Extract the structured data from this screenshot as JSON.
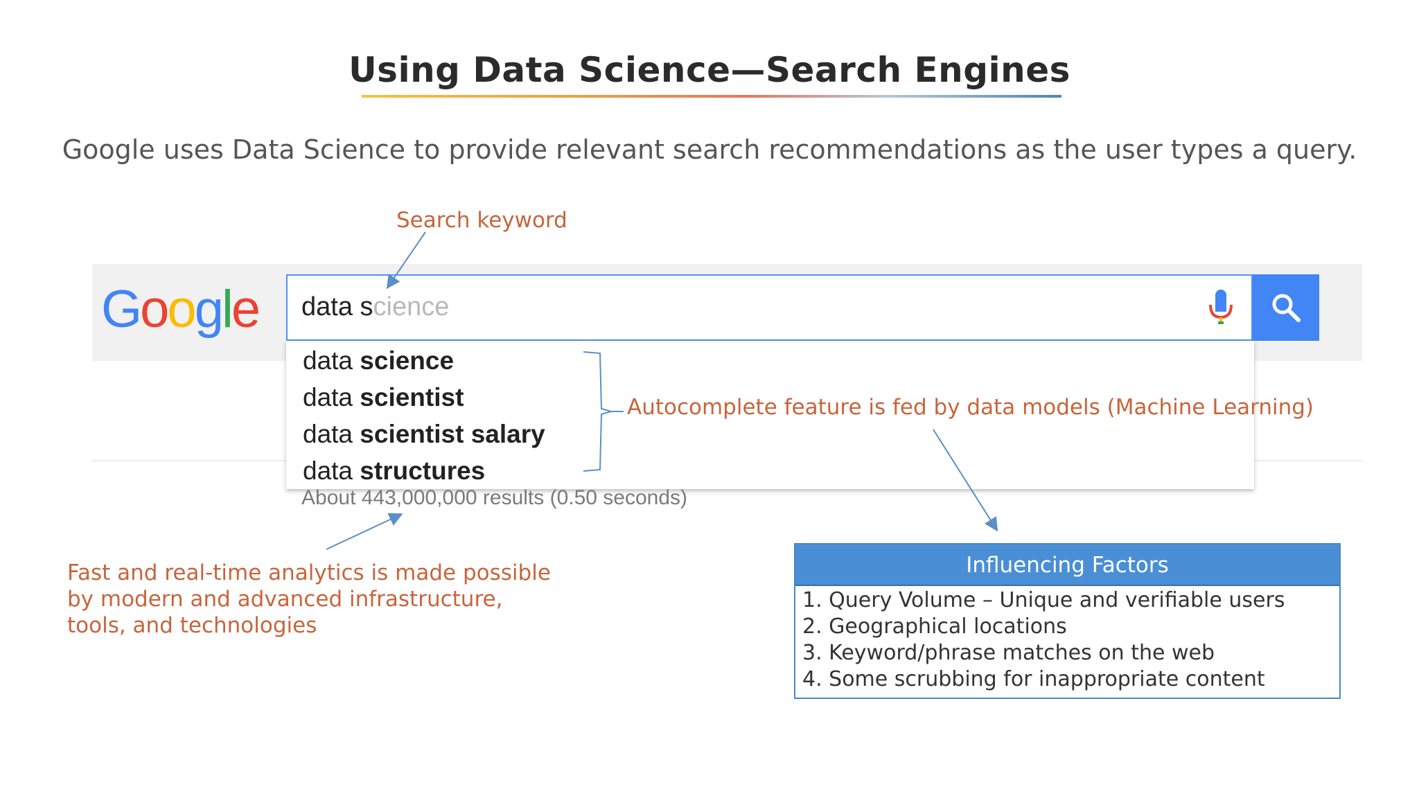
{
  "slide": {
    "title": "Using Data Science—Search Engines",
    "subtitle": "Google uses Data Science to provide relevant search recommendations as the user types a query."
  },
  "annotations": {
    "search_keyword": "Search keyword",
    "autocomplete": "Autocomplete feature is fed by data models (Machine Learning)",
    "fast_analytics": [
      "Fast and real-time analytics is made possible",
      "by modern and advanced infrastructure,",
      "tools, and technologies"
    ]
  },
  "search": {
    "logo": "Google",
    "query_typed": "data s",
    "query_hint": "cience",
    "suggestions": [
      {
        "typed": "data ",
        "rest": "science"
      },
      {
        "typed": "data ",
        "rest": "scientist"
      },
      {
        "typed": "data ",
        "rest": "scientist salary"
      },
      {
        "typed": "data ",
        "rest": "structures"
      }
    ],
    "results_stats": "About 443,000,000 results (0.50 seconds)",
    "icons": {
      "mic": "microphone-icon",
      "search": "search-icon"
    },
    "colors": {
      "accent": "#4285f4",
      "border": "#4d90fe"
    }
  },
  "factors": {
    "header": "Influencing Factors",
    "items": [
      "1. Query Volume – Unique and verifiable users",
      "2. Geographical locations",
      "3. Keyword/phrase matches on the web",
      "4. Some scrubbing for inappropriate content"
    ],
    "header_color": "#4a8fd6"
  },
  "colors": {
    "annotation_text": "#c8643b",
    "arrow": "#5b8fc7"
  }
}
